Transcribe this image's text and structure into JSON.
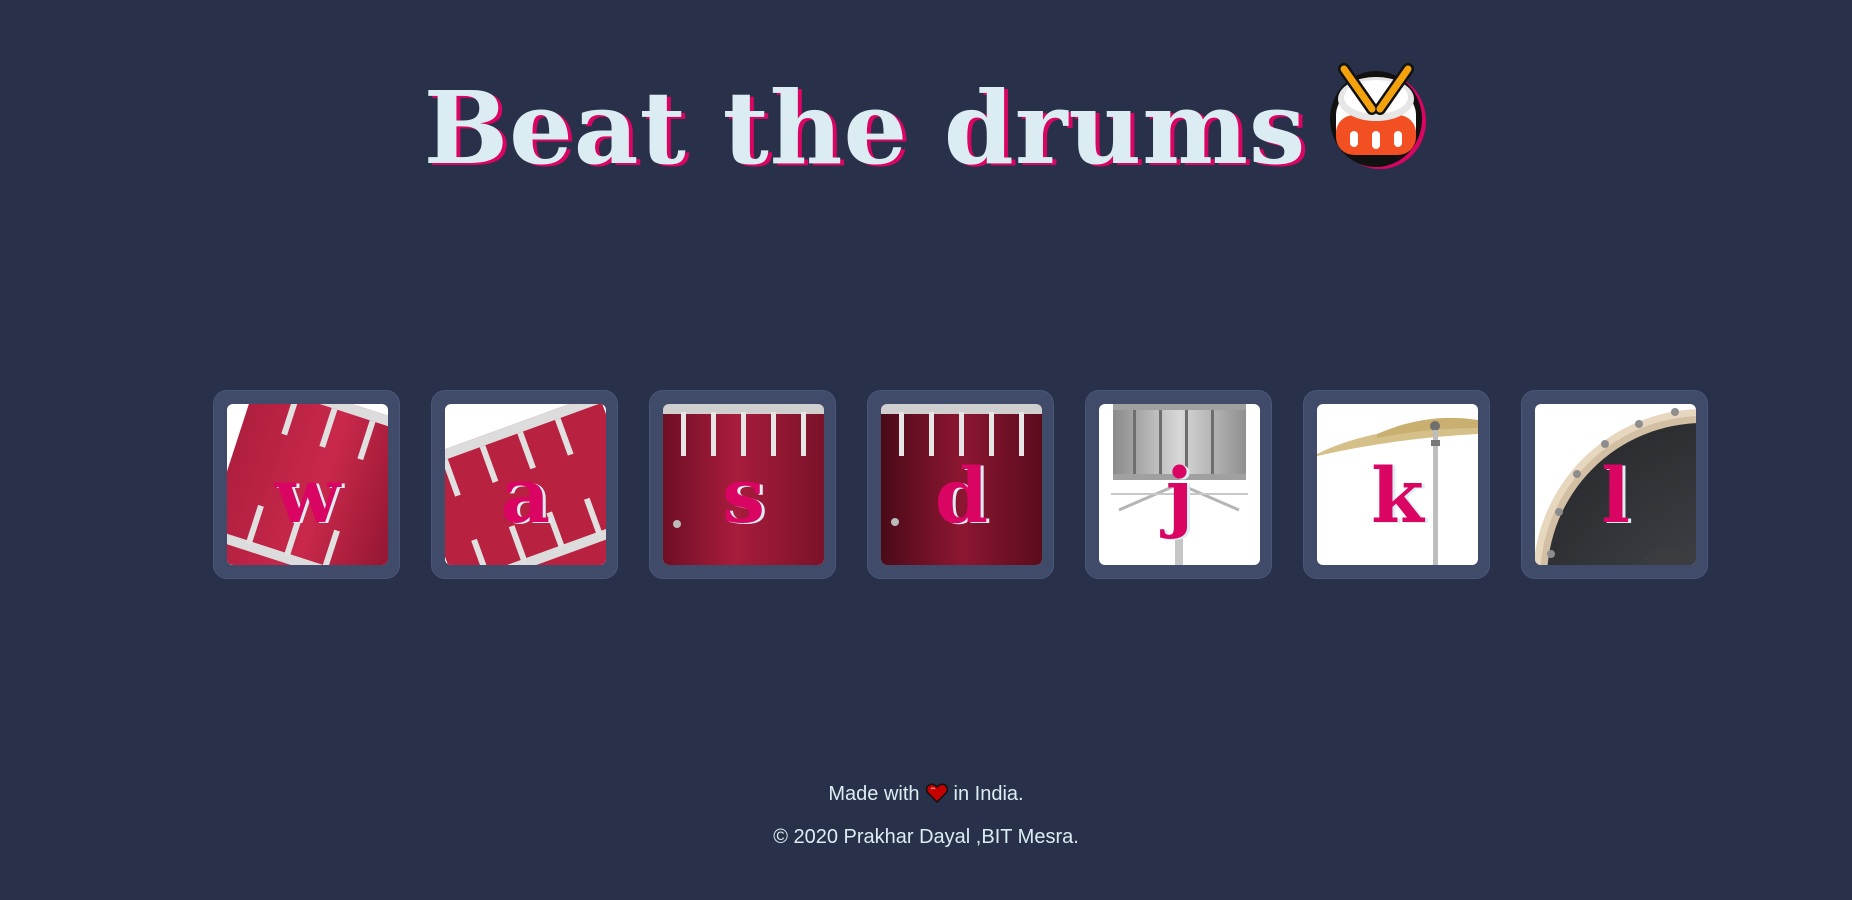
{
  "header": {
    "title": "Beat the drums",
    "title_icon": "drum-emoji-icon"
  },
  "drums": [
    {
      "key": "w",
      "image": "tom-drum-tilted-left"
    },
    {
      "key": "a",
      "image": "tom-drum-tilted-right"
    },
    {
      "key": "s",
      "image": "snare-drum"
    },
    {
      "key": "d",
      "image": "bass-drum-dark"
    },
    {
      "key": "j",
      "image": "silver-snare-on-stand"
    },
    {
      "key": "k",
      "image": "crash-cymbal"
    },
    {
      "key": "l",
      "image": "kick-drum"
    }
  ],
  "footer": {
    "made_prefix": "Made with",
    "made_icon": "heart-icon",
    "made_suffix": "in India.",
    "copyright": "© 2020 Prakhar Dayal ,BIT Mesra."
  },
  "colors": {
    "background": "#283149",
    "accent": "#da0463",
    "text": "#dbedf3",
    "tile_frame": "#404b69"
  }
}
